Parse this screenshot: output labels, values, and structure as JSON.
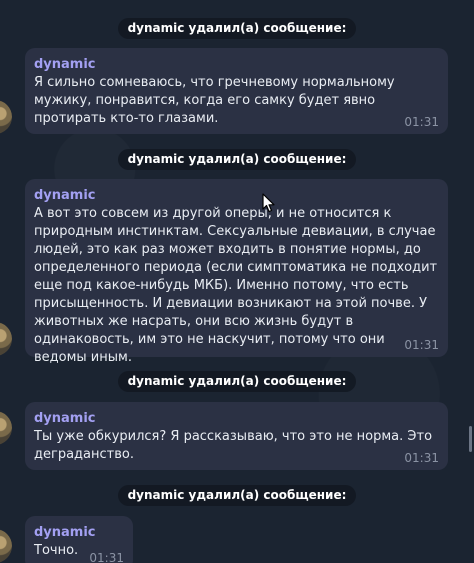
{
  "service_message": "dynamic удалил(а) сообщение:",
  "messages": [
    {
      "author": "dynamic",
      "text": "Я сильно сомневаюсь, что гречневому нормальному мужику, понравится, когда его самку будет явно протирать кто-то глазами.",
      "time": "01:31"
    },
    {
      "author": "dynamic",
      "text": "А вот это совсем из другой оперы, и не относится к природным инстинктам. Сексуальные девиации, в случае людей, это как раз может входить в понятие нормы, до определенного периода (если симптоматика не подходит еще под какое-нибудь МКБ). Именно потому, что есть присыщенность. И девиации возникают на этой почве. У животных же насрать, они всю жизнь будут в одинаковость, им это не наскучит, потому что они ведомы иным.",
      "time": "01:31"
    },
    {
      "author": "dynamic",
      "text": "Ты уже обкурился? Я рассказываю, что это не норма. Это деграданство.",
      "time": "01:31"
    },
    {
      "author": "dynamic",
      "text": "Точно.",
      "time": "01:31"
    }
  ]
}
